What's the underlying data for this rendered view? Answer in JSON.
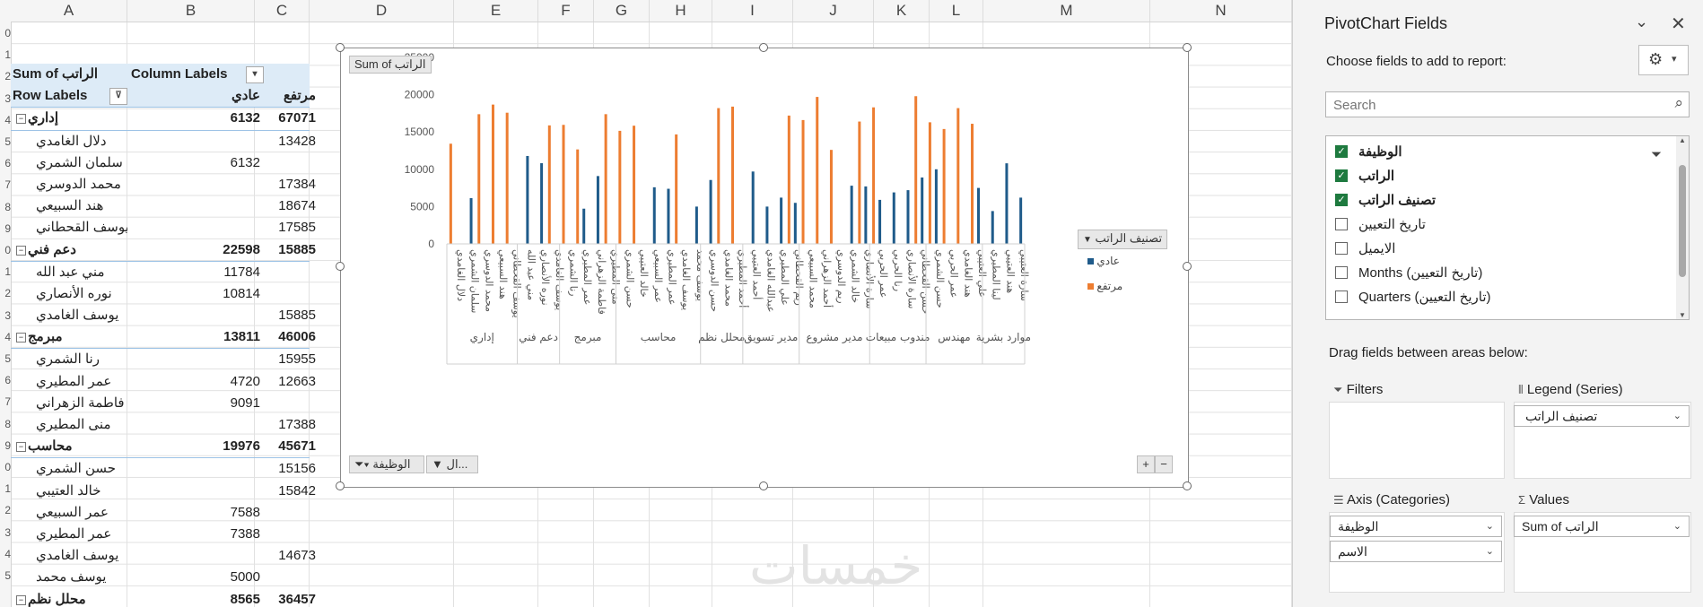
{
  "columns": [
    "A",
    "B",
    "C",
    "D",
    "E",
    "F",
    "G",
    "H",
    "I",
    "J",
    "K",
    "L",
    "M",
    "N"
  ],
  "pivot": {
    "header1": {
      "label": "Sum of الراتب",
      "col_labels": "Column Labels"
    },
    "header2": {
      "row_labels": "Row Labels",
      "c1": "عادي",
      "c2": "مرتفع"
    },
    "rows": [
      {
        "type": "grp",
        "label": "إداري",
        "v1": "6132",
        "v2": "67071"
      },
      {
        "type": "item",
        "label": "دلال الغامدي",
        "v1": "",
        "v2": "13428"
      },
      {
        "type": "item",
        "label": "سلمان الشمري",
        "v1": "6132",
        "v2": ""
      },
      {
        "type": "item",
        "label": "محمد الدوسري",
        "v1": "",
        "v2": "17384"
      },
      {
        "type": "item",
        "label": "هند السبيعي",
        "v1": "",
        "v2": "18674"
      },
      {
        "type": "item",
        "label": "يوسف القحطاني",
        "v1": "",
        "v2": "17585"
      },
      {
        "type": "grp",
        "label": "دعم فني",
        "v1": "22598",
        "v2": "15885"
      },
      {
        "type": "item",
        "label": "مني عبد الله",
        "v1": "11784",
        "v2": ""
      },
      {
        "type": "item",
        "label": "نوره الأنصاري",
        "v1": "10814",
        "v2": ""
      },
      {
        "type": "item",
        "label": "يوسف الغامدي",
        "v1": "",
        "v2": "15885"
      },
      {
        "type": "grp",
        "label": "مبرمج",
        "v1": "13811",
        "v2": "46006"
      },
      {
        "type": "item",
        "label": "رنا الشمري",
        "v1": "",
        "v2": "15955"
      },
      {
        "type": "item",
        "label": "عمر المطيري",
        "v1": "4720",
        "v2": "12663"
      },
      {
        "type": "item",
        "label": "فاطمة الزهراني",
        "v1": "9091",
        "v2": ""
      },
      {
        "type": "item",
        "label": "منى المطيري",
        "v1": "",
        "v2": "17388"
      },
      {
        "type": "grp",
        "label": "محاسب",
        "v1": "19976",
        "v2": "45671"
      },
      {
        "type": "item",
        "label": "حسن الشمري",
        "v1": "",
        "v2": "15156"
      },
      {
        "type": "item",
        "label": "خالد العتيبي",
        "v1": "",
        "v2": "15842"
      },
      {
        "type": "item",
        "label": "عمر السبيعي",
        "v1": "7588",
        "v2": ""
      },
      {
        "type": "item",
        "label": "عمر المطيري",
        "v1": "7388",
        "v2": ""
      },
      {
        "type": "item",
        "label": "يوسف الغامدي",
        "v1": "",
        "v2": "14673"
      },
      {
        "type": "item",
        "label": "يوسف محمد",
        "v1": "5000",
        "v2": ""
      },
      {
        "type": "grp",
        "label": "محلل نظم",
        "v1": "8565",
        "v2": "36457"
      }
    ],
    "row_numbers": [
      "0",
      "1",
      "2",
      "3",
      "4",
      "5",
      "6",
      "7",
      "8",
      "9",
      "0",
      "1",
      "2",
      "3",
      "4",
      "5",
      "6",
      "7",
      "8",
      "9",
      "0",
      "1",
      "2",
      "3",
      "4",
      "5"
    ]
  },
  "chart": {
    "value_button": "Sum of الراتب",
    "legend_title": "تصنيف الراتب",
    "axis_button": "الوظيفة",
    "axis_button2": "ال...",
    "plus": "+",
    "minus": "−"
  },
  "chart_data": {
    "type": "bar",
    "ylim": [
      0,
      25000
    ],
    "yticks": [
      "0",
      "5000",
      "10000",
      "15000",
      "20000",
      "25000"
    ],
    "series": [
      {
        "name": "عادي",
        "color": "#1f5b8a"
      },
      {
        "name": "مرتفع",
        "color": "#ed7d31"
      }
    ],
    "groups": [
      {
        "label": "إداري",
        "items": [
          [
            "دلال الغامدي",
            0,
            13428
          ],
          [
            "سلمان الشمري",
            6132,
            0
          ],
          [
            "محمد الدوسري",
            0,
            17384
          ],
          [
            "هند السبيعي",
            0,
            18674
          ],
          [
            "يوسف القحطاني",
            0,
            17585
          ]
        ]
      },
      {
        "label": "دعم فني",
        "items": [
          [
            "مني عبد الله",
            11784,
            0
          ],
          [
            "نوره الأنصاري",
            10814,
            0
          ],
          [
            "يوسف الغامدي",
            0,
            15885
          ]
        ]
      },
      {
        "label": "مبرمج",
        "items": [
          [
            "رنا الشمري",
            0,
            15955
          ],
          [
            "عمر المطيري",
            4720,
            12663
          ],
          [
            "فاطمة الزهراني",
            9091,
            0
          ],
          [
            "منى المطيري",
            0,
            17388
          ]
        ]
      },
      {
        "label": "محاسب",
        "items": [
          [
            "حسن الشمري",
            0,
            15156
          ],
          [
            "خالد العتيبي",
            0,
            15842
          ],
          [
            "عمر السبيعي",
            7588,
            0
          ],
          [
            "عمر المطيري",
            7388,
            0
          ],
          [
            "يوسف الغامدي",
            0,
            14673
          ],
          [
            "يوسف محمد",
            5000,
            0
          ]
        ]
      },
      {
        "label": "محلل نظم",
        "items": [
          [
            "حسن الدوسري",
            8565,
            0
          ],
          [
            "محمد الغامدي",
            0,
            18200
          ],
          [
            "أحمد المطيري",
            0,
            18400
          ]
        ]
      },
      {
        "label": "مدير تسويق",
        "items": [
          [
            "أحمد العتيبي",
            9700,
            0
          ],
          [
            "عبدالله الغامدي",
            5000,
            0
          ],
          [
            "علي المطيري",
            6200,
            0
          ],
          [
            "ريم القحطاني",
            5500,
            17200
          ]
        ]
      },
      {
        "label": "مدير مشروع",
        "items": [
          [
            "محمد السبيعي",
            0,
            16600
          ],
          [
            "أحمد الزهراني",
            0,
            19700
          ],
          [
            "ريم الدوسري",
            0,
            12600
          ],
          [
            "خالد الشمري",
            7800,
            0
          ],
          [
            "سارة الأنصاري",
            7700,
            16400
          ]
        ]
      },
      {
        "label": "مندوب مبيعات",
        "items": [
          [
            "عمر الحربي",
            5900,
            18300
          ],
          [
            "رنا الحربي",
            6900,
            0
          ],
          [
            "سارة الأنصاري",
            7200,
            0
          ],
          [
            "حسن القحطاني",
            8900,
            19800
          ]
        ]
      },
      {
        "label": "مهندس",
        "items": [
          [
            "حسن الشمري",
            10000,
            16300
          ],
          [
            "عمر الحربي",
            0,
            15400
          ],
          [
            "هند الغامدي",
            0,
            18200
          ],
          [
            "علي العتيبي",
            7500,
            16100
          ]
        ]
      },
      {
        "label": "موارد بشرية",
        "items": [
          [
            "لينا المطيري",
            4400,
            0
          ],
          [
            "هند العتيبي",
            10800,
            0
          ],
          [
            "سارة العتيبي",
            6200,
            0
          ]
        ]
      }
    ],
    "x_tick_labels_visible": [
      "دلال الغامدي",
      "محمد الدوسري",
      "يوسف القحطاني",
      "نوره الأنصاري",
      "رنا الشمري",
      "فاطمة الزهراني",
      "حسن الشمري",
      "عمر السبيعي",
      "يوسف الغامدي",
      "حسن الدوسري",
      "محمد الغامدي",
      "أحمد العتيبي",
      "عبدالله الغامدي",
      "علي المطيري",
      "ريم القحطاني",
      "محمد السبيعي",
      "أحمد الزهراني",
      "رنا الحربي",
      "سارة الأنصاري",
      "حسن الشمري",
      "عمر الحربي",
      "هند الغامدي",
      "لينا المطيري",
      "هند العتيبي"
    ]
  },
  "panel": {
    "title": "PivotChart Fields",
    "choose": "Choose fields to add to report:",
    "search_placeholder": "Search",
    "fields": [
      {
        "name": "الوظيفة",
        "checked": true
      },
      {
        "name": "الراتب",
        "checked": true
      },
      {
        "name": "تصنيف الراتب",
        "checked": true
      },
      {
        "name": "تاريخ التعيين",
        "checked": false
      },
      {
        "name": "الايميل",
        "checked": false
      },
      {
        "name": "Months (تاريخ التعيين)",
        "checked": false
      },
      {
        "name": "Quarters (تاريخ التعيين)",
        "checked": false
      }
    ],
    "drag_text": "Drag fields between areas below:",
    "filters": "Filters",
    "legend": "Legend (Series)",
    "legend_item": "تصنيف الراتب",
    "axis": "Axis (Categories)",
    "axis_item1": "الوظيفة",
    "axis_item2": "الاسم",
    "values": "Values",
    "values_item": "Sum of الراتب"
  },
  "watermark": "خمسات"
}
